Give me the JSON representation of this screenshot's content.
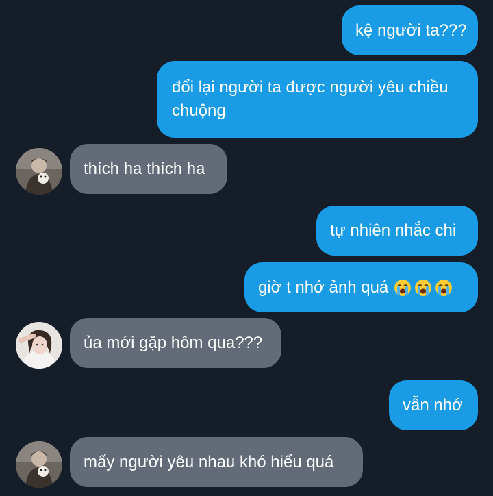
{
  "messages": [
    {
      "side": "out",
      "text": "kệ người ta???"
    },
    {
      "side": "out",
      "text": "đổi lại người ta được người yêu chiều chuộng"
    },
    {
      "side": "in",
      "text": "thích ha thích ha",
      "avatar": "avatar-photo-1"
    },
    {
      "side": "out",
      "text": "tự nhiên nhắc chi"
    },
    {
      "side": "out",
      "text": "giờ t nhớ ảnh quá",
      "emoji": [
        "loudly-crying-face",
        "loudly-crying-face",
        "loudly-crying-face"
      ]
    },
    {
      "side": "in",
      "text": "ủa mới gặp hôm qua???",
      "avatar": "avatar-photo-2"
    },
    {
      "side": "out",
      "text": "vẫn nhớ"
    },
    {
      "side": "in",
      "text": "mấy người yêu nhau khó hiểu quá",
      "avatar": "avatar-photo-1"
    }
  ],
  "colors": {
    "background": "#151d28",
    "outgoing_bubble": "#1a9be6",
    "incoming_bubble": "#626b77",
    "text": "#ffffff"
  }
}
